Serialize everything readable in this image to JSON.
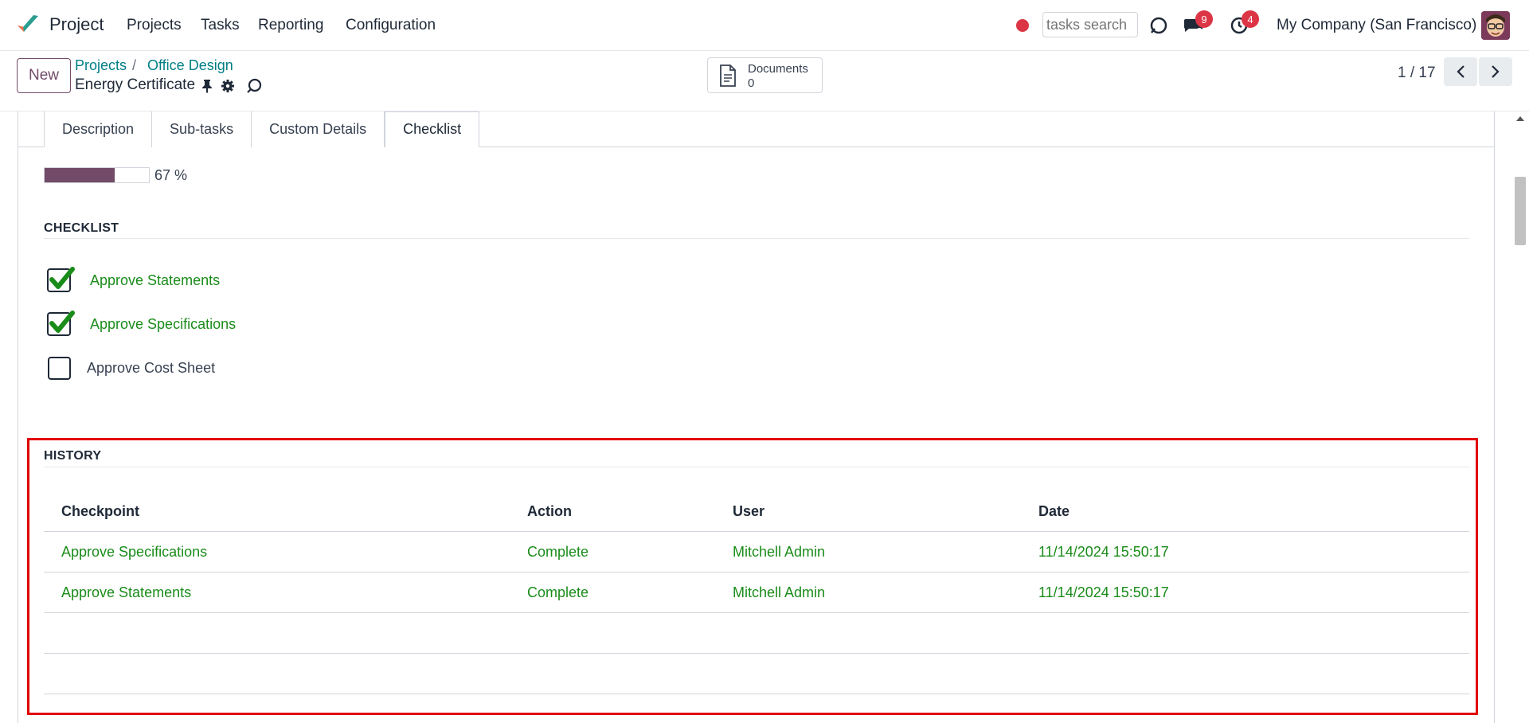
{
  "navbar": {
    "app_name": "Project",
    "menu": [
      "Projects",
      "Tasks",
      "Reporting",
      "Configuration"
    ],
    "search_placeholder": "tasks search",
    "messages_count": "9",
    "activities_count": "4",
    "company": "My Company (San Francisco)"
  },
  "control": {
    "new_label": "New",
    "breadcrumb": [
      "Projects",
      "Office Design"
    ],
    "breadcrumb_sep": "/",
    "record_name": "Energy Certificate",
    "documents_label": "Documents",
    "documents_count": "0",
    "pager": "1 / 17"
  },
  "tabs": [
    "Description",
    "Sub-tasks",
    "Custom Details",
    "Checklist"
  ],
  "progress": {
    "percent": 67,
    "text": "67 %"
  },
  "checklist": {
    "title": "CHECKLIST",
    "items": [
      {
        "label": "Approve Statements",
        "checked": true
      },
      {
        "label": "Approve Specifications",
        "checked": true
      },
      {
        "label": "Approve Cost Sheet",
        "checked": false
      }
    ]
  },
  "history": {
    "title": "HISTORY",
    "columns": [
      "Checkpoint",
      "Action",
      "User",
      "Date"
    ],
    "rows": [
      [
        "Approve Specifications",
        "Complete",
        "Mitchell Admin",
        "11/14/2024 15:50:17"
      ],
      [
        "Approve Statements",
        "Complete",
        "Mitchell Admin",
        "11/14/2024 15:50:17"
      ]
    ]
  },
  "colors": {
    "brand": "#714b67",
    "link": "#017e84",
    "done": "#1a8c1a",
    "highlight": "#e00000"
  }
}
